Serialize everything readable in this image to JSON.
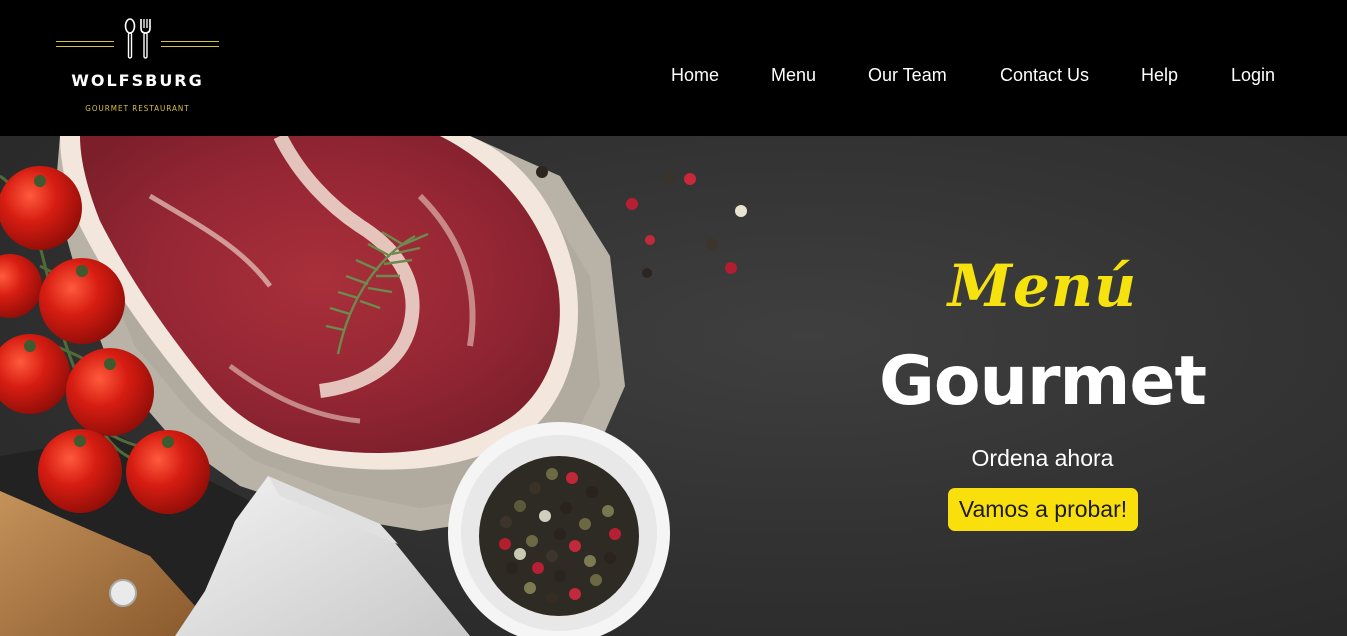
{
  "brand": {
    "name": "WOLFSBURG",
    "tagline": "GOURMET RESTAURANT",
    "icon": "fork-spoon-icon",
    "accent_color": "#d8c23a"
  },
  "nav": {
    "items": [
      {
        "label": "Home"
      },
      {
        "label": "Menu"
      },
      {
        "label": "Our Team"
      },
      {
        "label": "Contact Us"
      },
      {
        "label": "Help"
      },
      {
        "label": "Login"
      }
    ]
  },
  "hero": {
    "script_title": "Menú",
    "title": "Gourmet",
    "subtitle": "Ordena ahora",
    "cta_label": "Vamos a probar!",
    "script_color": "#f5e20f",
    "cta_color": "#f9e00d",
    "image": "raw-steak-tomatoes-peppercorns-cleaver-photo"
  }
}
